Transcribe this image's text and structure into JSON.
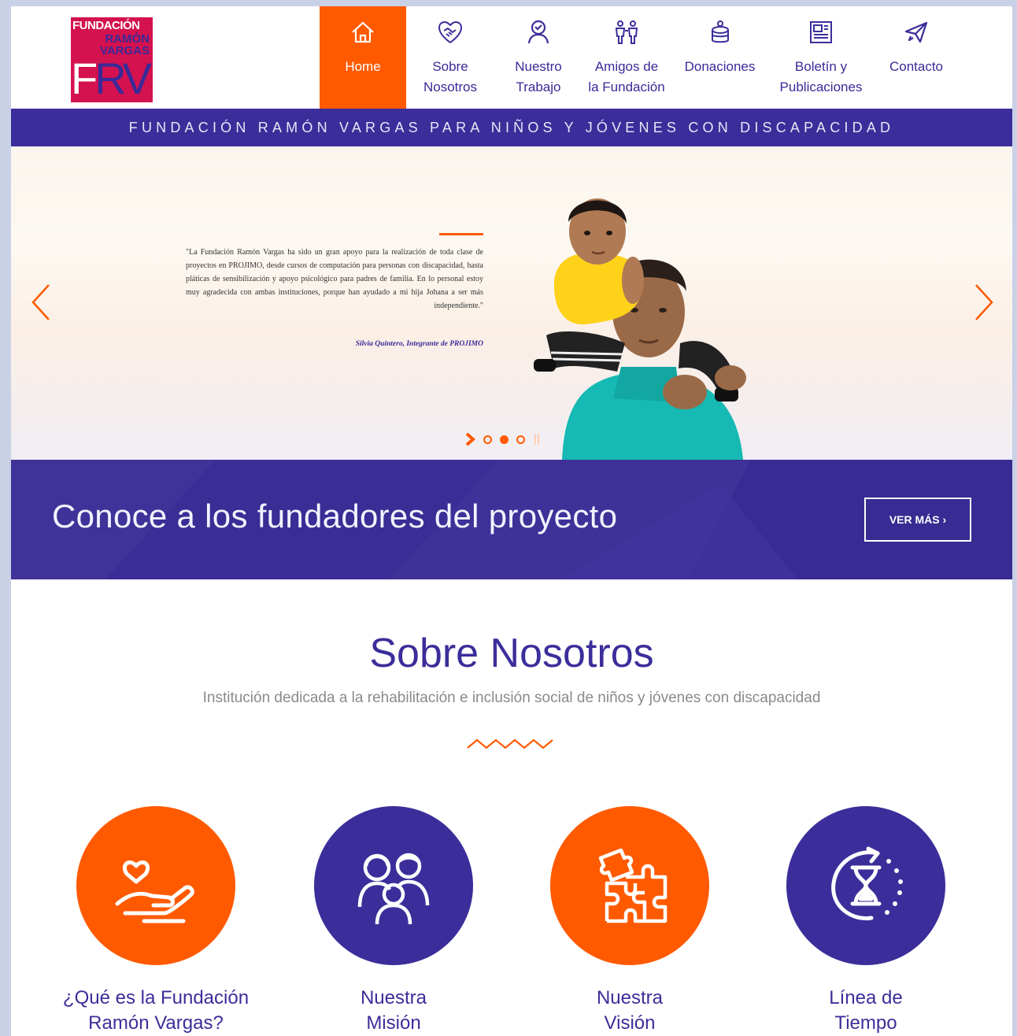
{
  "logo": {
    "line1": "FUNDACIÓN",
    "line2": "RAMÓN",
    "line3": "VARGAS",
    "mark_f": "F",
    "mark_rv": "RV"
  },
  "nav": [
    {
      "label": "Home",
      "icon": "home-icon",
      "active": true
    },
    {
      "label": "Sobre\nNosotros",
      "icon": "heart-hands-icon"
    },
    {
      "label": "Nuestro\nTrabajo",
      "icon": "person-icon"
    },
    {
      "label": "Amigos de\nla Fundación",
      "icon": "people-icon"
    },
    {
      "label": "Donaciones",
      "icon": "coins-icon"
    },
    {
      "label": "Boletín y\nPublicaciones",
      "icon": "newspaper-icon"
    },
    {
      "label": "Contacto",
      "icon": "paper-plane-icon"
    }
  ],
  "tagline": "FUNDACIÓN RAMÓN VARGAS PARA NIÑOS Y JÓVENES CON DISCAPACIDAD",
  "slider": {
    "quote": "\"La Fundación Ramón Vargas ha sido un gran apoyo para la realización de toda clase de proyectos en PROJIMO, desde cursos de computación para personas con discapacidad, hasta pláticas de sensibilización y apoyo psicológico para padres de familia. En lo personal estoy muy agradecida con ambas instituciones, porque han ayudado a mi hija Johana a ser más independiente.\"",
    "author": "Silvia Quintero, Integrante de PROJIMO",
    "dots": 3,
    "active_dot": 1
  },
  "founders": {
    "title": "Conoce a los fundadores del proyecto",
    "button": "VER MÁS  ›"
  },
  "about": {
    "title": "Sobre Nosotros",
    "subtitle": "Institución dedicada a la rehabilitación e inclusión social de niños y jóvenes con discapacidad",
    "cards": [
      {
        "title": "¿Qué es la Fundación\nRamón Vargas?",
        "color": "orange",
        "icon": "heart-in-hand-icon"
      },
      {
        "title": "Nuestra\nMisión",
        "color": "purple",
        "icon": "family-icon"
      },
      {
        "title": "Nuestra\nVisión",
        "color": "orange",
        "icon": "puzzle-icon"
      },
      {
        "title": "Línea de\nTiempo",
        "color": "purple",
        "icon": "hourglass-icon"
      }
    ]
  },
  "colors": {
    "orange": "#ff5a00",
    "purple": "#3b2e9a",
    "logo_red": "#d4124f"
  }
}
